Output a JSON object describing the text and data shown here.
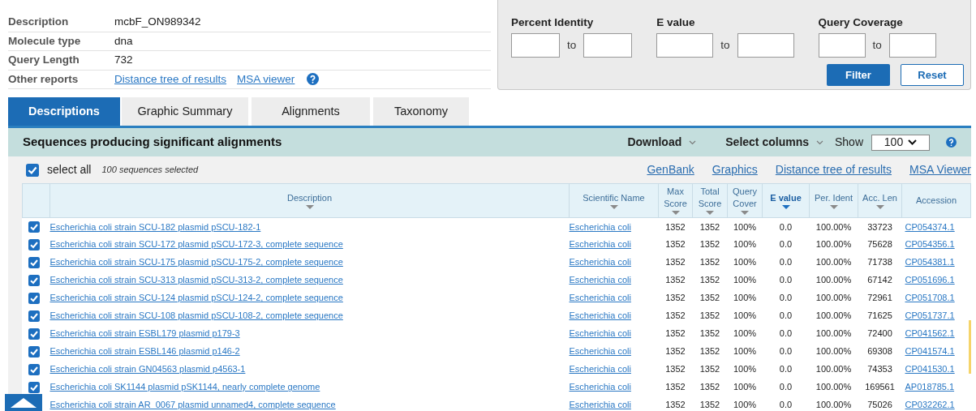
{
  "query_info": [
    {
      "label": "Description",
      "value": "mcbF_ON989342",
      "kind": "text"
    },
    {
      "label": "Molecule type",
      "value": "dna",
      "kind": "text"
    },
    {
      "label": "Query Length",
      "value": "732",
      "kind": "text"
    },
    {
      "label": "Other reports",
      "links": [
        "Distance tree of results",
        "MSA viewer"
      ],
      "kind": "links"
    }
  ],
  "filter": {
    "groups": [
      {
        "label": "Percent Identity",
        "separator": "to"
      },
      {
        "label": "E value",
        "separator": "to"
      },
      {
        "label": "Query Coverage",
        "separator": "to"
      }
    ],
    "buttons": [
      {
        "label": "Filter",
        "kind": "primary"
      },
      {
        "label": "Reset",
        "kind": "secondary"
      }
    ]
  },
  "tabs": [
    {
      "label": "Descriptions",
      "selected": true
    },
    {
      "label": "Graphic Summary",
      "selected": false
    },
    {
      "label": "Alignments",
      "selected": false
    },
    {
      "label": "Taxonomy",
      "selected": false
    }
  ],
  "results": {
    "title": "Sequences producing significant alignments",
    "download": "Download",
    "select_columns": "Select columns",
    "show_label": "Show",
    "show_value": "100",
    "select_all": {
      "label": "select all",
      "checked": true,
      "count": "100 sequences selected"
    },
    "links": [
      "GenBank",
      "Graphics",
      "Distance tree of results",
      "MSA Viewer"
    ],
    "columns": [
      {
        "label": "Description",
        "sortable": true,
        "sorted": false
      },
      {
        "label": "Scientific Name",
        "sortable": true,
        "sorted": false
      },
      {
        "label": "Max Score",
        "sortable": true,
        "sorted": false
      },
      {
        "label": "Total Score",
        "sortable": true,
        "sorted": false
      },
      {
        "label": "Query Cover",
        "sortable": true,
        "sorted": false
      },
      {
        "label": "E value",
        "sortable": true,
        "sorted": true
      },
      {
        "label": "Per. Ident",
        "sortable": true,
        "sorted": false
      },
      {
        "label": "Acc. Len",
        "sortable": true,
        "sorted": false
      },
      {
        "label": "Accession",
        "sortable": false,
        "sorted": false
      }
    ],
    "rows": [
      {
        "checked": true,
        "cells": [
          "Escherichia coli strain SCU-182 plasmid pSCU-182-1",
          "Escherichia coli",
          "1352",
          "1352",
          "100%",
          "0.0",
          "100.00%",
          "33723",
          "CP054374.1"
        ]
      },
      {
        "checked": true,
        "cells": [
          "Escherichia coli strain SCU-172 plasmid pSCU-172-3, complete sequence",
          "Escherichia coli",
          "1352",
          "1352",
          "100%",
          "0.0",
          "100.00%",
          "75628",
          "CP054356.1"
        ]
      },
      {
        "checked": true,
        "cells": [
          "Escherichia coli strain SCU-175 plasmid pSCU-175-2, complete sequence",
          "Escherichia coli",
          "1352",
          "1352",
          "100%",
          "0.0",
          "100.00%",
          "71738",
          "CP054381.1"
        ]
      },
      {
        "checked": true,
        "cells": [
          "Escherichia coli strain SCU-313 plasmid pSCU-313-2, complete sequence",
          "Escherichia coli",
          "1352",
          "1352",
          "100%",
          "0.0",
          "100.00%",
          "67142",
          "CP051696.1"
        ]
      },
      {
        "checked": true,
        "cells": [
          "Escherichia coli strain SCU-124 plasmid pSCU-124-2, complete sequence",
          "Escherichia coli",
          "1352",
          "1352",
          "100%",
          "0.0",
          "100.00%",
          "72961",
          "CP051708.1"
        ]
      },
      {
        "checked": true,
        "cells": [
          "Escherichia coli strain SCU-108 plasmid pSCU-108-2, complete sequence",
          "Escherichia coli",
          "1352",
          "1352",
          "100%",
          "0.0",
          "100.00%",
          "71625",
          "CP051737.1"
        ]
      },
      {
        "checked": true,
        "cells": [
          "Escherichia coli strain ESBL179 plasmid p179-3",
          "Escherichia coli",
          "1352",
          "1352",
          "100%",
          "0.0",
          "100.00%",
          "72400",
          "CP041562.1"
        ]
      },
      {
        "checked": true,
        "cells": [
          "Escherichia coli strain ESBL146 plasmid p146-2",
          "Escherichia coli",
          "1352",
          "1352",
          "100%",
          "0.0",
          "100.00%",
          "69308",
          "CP041574.1"
        ]
      },
      {
        "checked": true,
        "cells": [
          "Escherichia coli strain GN04563 plasmid p4563-1",
          "Escherichia coli",
          "1352",
          "1352",
          "100%",
          "0.0",
          "100.00%",
          "74353",
          "CP041530.1"
        ]
      },
      {
        "checked": true,
        "cells": [
          "Escherichia coli SK1144 plasmid pSK1144, nearly complete genome",
          "Escherichia coli",
          "1352",
          "1352",
          "100%",
          "0.0",
          "100.00%",
          "169561",
          "AP018785.1"
        ]
      },
      {
        "cells": [
          "Escherichia coli strain AR_0067 plasmid unnamed4, complete sequence",
          "Escherichia coli",
          "1352",
          "1352",
          "100%",
          "0.0",
          "100.00%",
          "75026",
          "CP032262.1"
        ]
      }
    ]
  }
}
